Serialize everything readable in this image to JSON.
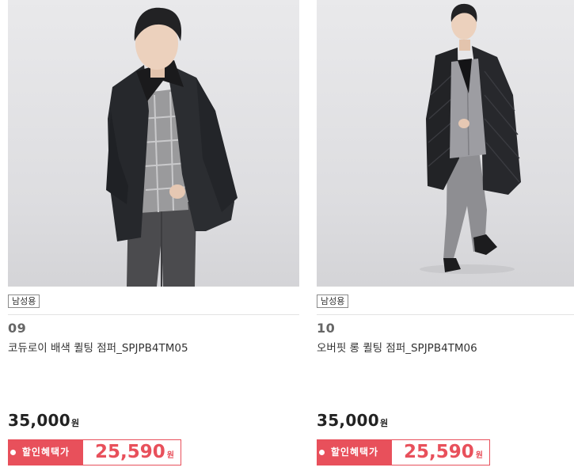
{
  "products": [
    {
      "gender_tag": "남성용",
      "number": "09",
      "name": "코듀로이 배색 퀼팅 점퍼_SPJPB4TM05",
      "price": "35,000",
      "price_unit": "원",
      "discount_label": "할인혜택가",
      "discount_price": "25,590",
      "discount_unit": "원"
    },
    {
      "gender_tag": "남성용",
      "number": "10",
      "name": "오버핏 롱 퀼팅 점퍼_SPJPB4TM06",
      "price": "35,000",
      "price_unit": "원",
      "discount_label": "할인혜택가",
      "discount_price": "25,590",
      "discount_unit": "원"
    }
  ],
  "colors": {
    "accent": "#e8505b",
    "photo_bg": "#e3e3e6",
    "text": "#333333"
  }
}
